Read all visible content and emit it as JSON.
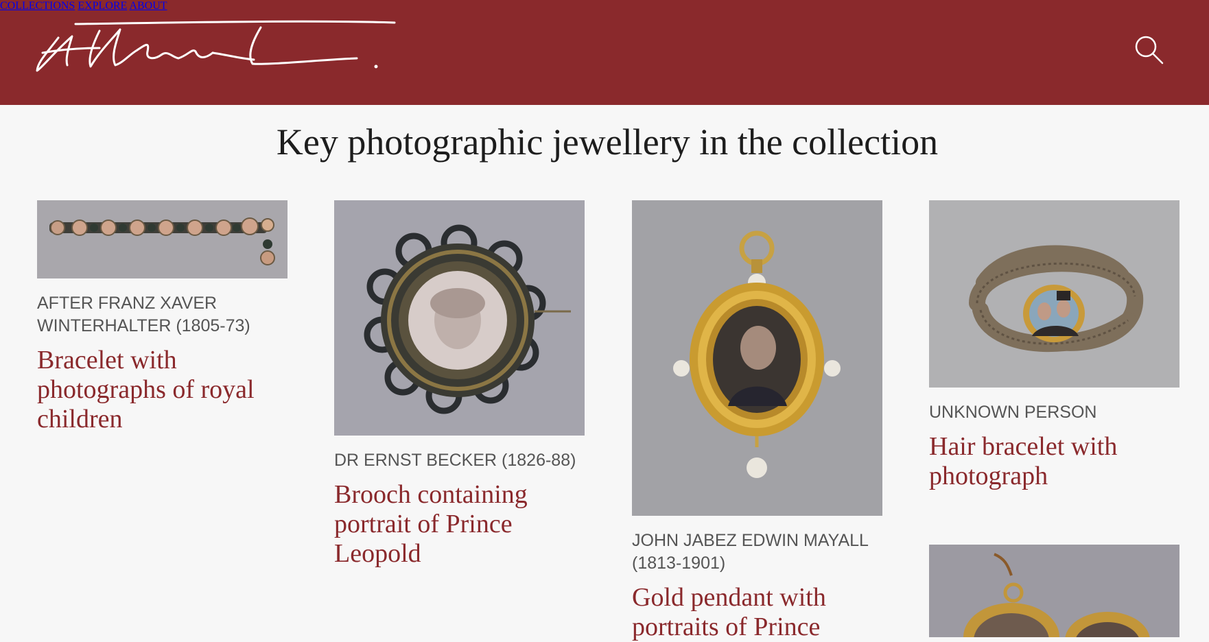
{
  "site": {
    "logo_text": "Albert",
    "nav": [
      "COLLECTIONS",
      "EXPLORE",
      "ABOUT"
    ],
    "search_icon": "search-icon",
    "brand_color": "#8a292c"
  },
  "page": {
    "heading": "Key photographic jewellery in the collection"
  },
  "items": [
    {
      "maker": "AFTER FRANZ XAVER WINTERHALTER (1805-73)",
      "title": "Bracelet with photographs of royal children"
    },
    {
      "maker": "DR ERNST BECKER (1826-88)",
      "title": "Brooch containing portrait of Prince Leopold"
    },
    {
      "maker": "JOHN JABEZ EDWIN MAYALL (1813-1901)",
      "title": "Gold pendant with portraits of Prince"
    },
    {
      "maker": "UNKNOWN PERSON",
      "title": "Hair bracelet with photograph"
    },
    {
      "maker": "",
      "title": ""
    }
  ]
}
